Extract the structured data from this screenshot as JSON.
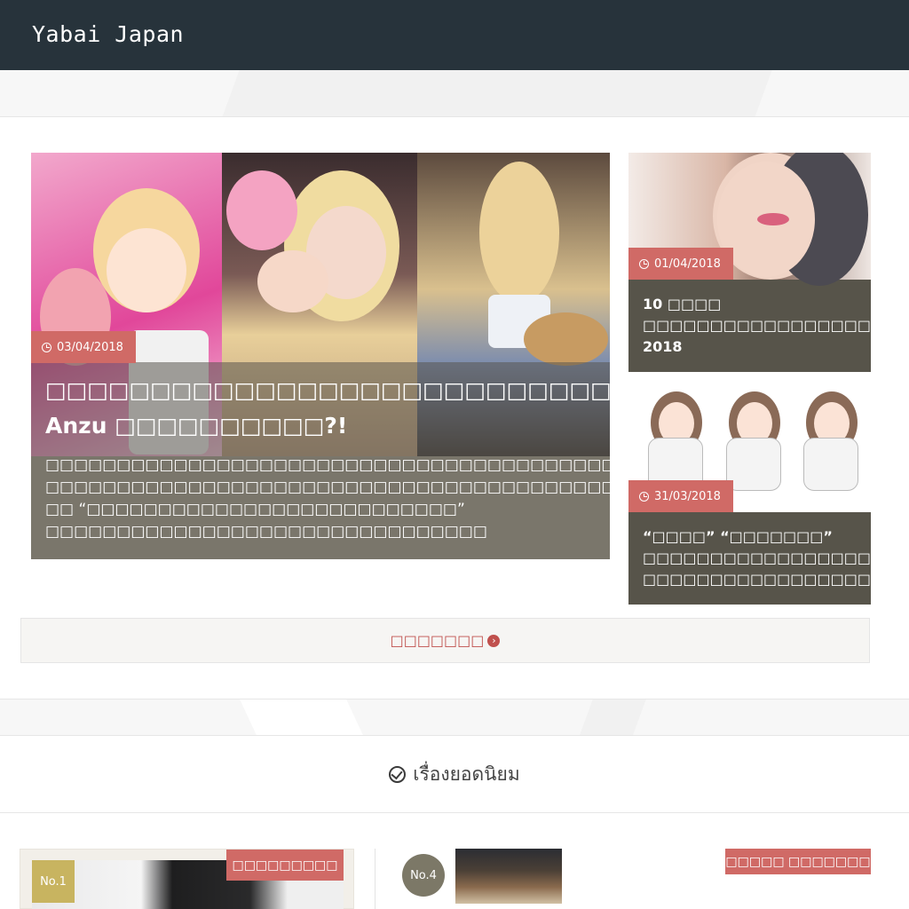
{
  "header": {
    "logo": "Yabai Japan"
  },
  "featured": {
    "date": "03/04/2018",
    "title_line1": "□□□□□□□□□□□□□□□□□□□□□□□□□□□□□□□□",
    "title_line2": "Anzu □□□□□□□□□□?!",
    "excerpt": [
      "□□□□□□□□□□□□□□□□□□□□□□□□□□□□□□□□□□□□□□□□□",
      "□□□□□□□□□□□□□□□□□□□□□□□□□□□□□□□□□□□□□□□□□",
      "□□ “□□□□□□□□□□□□□□□□□□□□□□□□□□”",
      "□□□□□□□□□□□□□□□□□□□□□□□□□□□□□□□"
    ]
  },
  "side_posts": [
    {
      "date": "01/04/2018",
      "title_lines": [
        "10 □□□□",
        "□□□□□□□□□□□□□□□□□□□□",
        "2018"
      ]
    },
    {
      "date": "31/03/2018",
      "title_lines": [
        "“□□□□” “□□□□□□□”",
        "□□□□□□□□□□□□□□□□□□",
        "□□□□□□□□□□□□□□□□□□"
      ]
    }
  ],
  "more_button": {
    "label": "□□□□□□□"
  },
  "popular": {
    "heading": "เรื่องยอดนิยม",
    "items": [
      {
        "rank": "No.1",
        "category": "□□□□□□□□□"
      },
      {
        "rank": "No.4",
        "category": "□□□□□ □□□□□□□"
      }
    ]
  },
  "colors": {
    "header_bg": "#27333b",
    "accent": "#d06a66",
    "card_bg": "#57544a"
  }
}
